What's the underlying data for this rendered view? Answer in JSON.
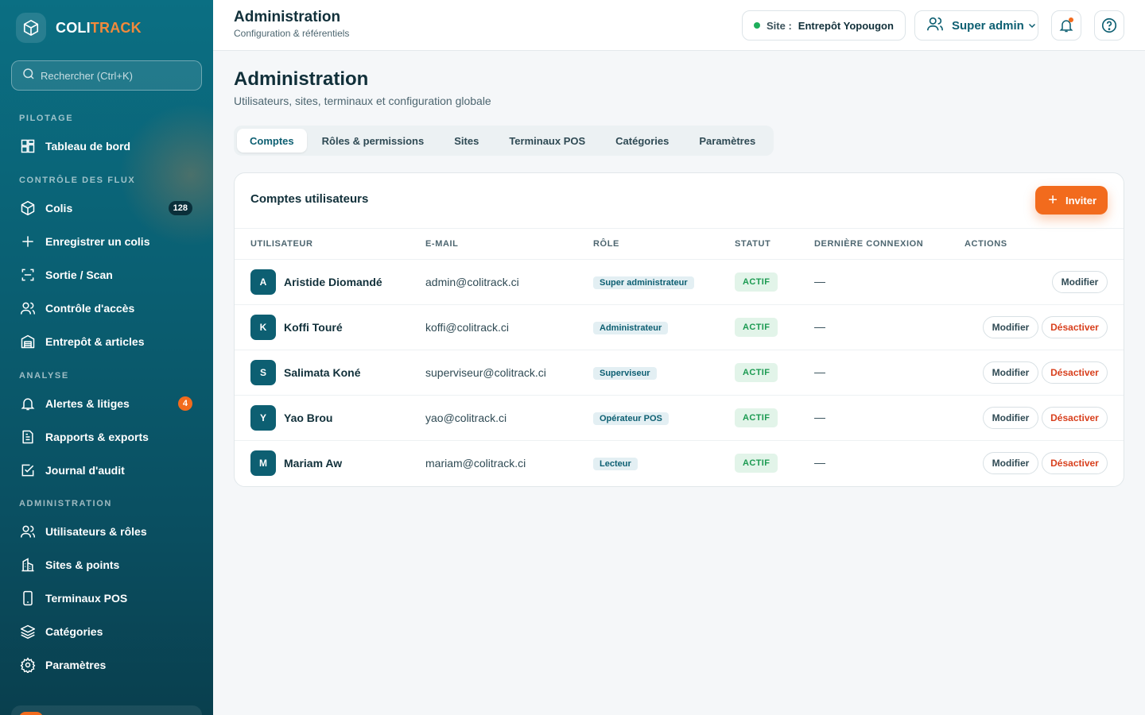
{
  "brand": {
    "name_part1": "COLI",
    "name_part2": "TRACK",
    "accent": "#f28a3c"
  },
  "sidebar": {
    "search_placeholder": "Rechercher (Ctrl+K)",
    "sections": {
      "pilotage": "PILOTAGE",
      "flux": "CONTRÔLE DES FLUX",
      "analyse": "ANALYSE",
      "admin": "ADMINISTRATION"
    },
    "items": {
      "dashboard": {
        "label": "Tableau de bord",
        "icon": "dashboard-icon"
      },
      "colis": {
        "label": "Colis",
        "icon": "package-icon",
        "badge": "128"
      },
      "register": {
        "label": "Enregistrer un colis",
        "icon": "plus-icon"
      },
      "scan": {
        "label": "Sortie / Scan",
        "icon": "scan-icon"
      },
      "access": {
        "label": "Contrôle d'accès",
        "icon": "users-icon"
      },
      "warehouse": {
        "label": "Entrepôt & articles",
        "icon": "warehouse-icon"
      },
      "alerts": {
        "label": "Alertes & litiges",
        "icon": "bell-icon",
        "badge": "4"
      },
      "reports": {
        "label": "Rapports & exports",
        "icon": "report-icon"
      },
      "audit": {
        "label": "Journal d'audit",
        "icon": "checklist-icon"
      },
      "users": {
        "label": "Utilisateurs & rôles",
        "icon": "users-icon"
      },
      "sites": {
        "label": "Sites & points",
        "icon": "building-icon"
      },
      "pos": {
        "label": "Terminaux POS",
        "icon": "device-icon"
      },
      "categories": {
        "label": "Catégories",
        "icon": "layers-icon"
      },
      "settings": {
        "label": "Paramètres",
        "icon": "gear-icon"
      }
    }
  },
  "topbar": {
    "title": "Administration",
    "subtitle": "Configuration & référentiels",
    "site_key": "Site :",
    "site_value": "Entrepôt Yopougon",
    "user_name": "Super admin",
    "status_color": "#1fae5b"
  },
  "main": {
    "title": "Administration",
    "subtitle": "Utilisateurs, sites, terminaux et configuration globale",
    "tabs": [
      "Comptes",
      "Rôles & permissions",
      "Sites",
      "Terminaux POS",
      "Catégories",
      "Paramètres"
    ],
    "active_tab": "Comptes"
  },
  "accounts": {
    "title": "Comptes utilisateurs",
    "invite_label": "Inviter",
    "columns": [
      "UTILISATEUR",
      "E-MAIL",
      "RÔLE",
      "STATUT",
      "DERNIÈRE CONNEXION",
      "ACTIONS"
    ],
    "rows": [
      {
        "initial": "A",
        "name": "Aristide Diomandé",
        "email": "admin@colitrack.ci",
        "role": "Super administrateur",
        "status": "ACTIF",
        "last_login": "—",
        "edit": "Modifier",
        "deactivate": ""
      },
      {
        "initial": "K",
        "name": "Koffi Touré",
        "email": "koffi@colitrack.ci",
        "role": "Administrateur",
        "status": "ACTIF",
        "last_login": "—",
        "edit": "Modifier",
        "deactivate": "Désactiver"
      },
      {
        "initial": "S",
        "name": "Salimata Koné",
        "email": "superviseur@colitrack.ci",
        "role": "Superviseur",
        "status": "ACTIF",
        "last_login": "—",
        "edit": "Modifier",
        "deactivate": "Désactiver"
      },
      {
        "initial": "Y",
        "name": "Yao Brou",
        "email": "yao@colitrack.ci",
        "role": "Opérateur POS",
        "status": "ACTIF",
        "last_login": "—",
        "edit": "Modifier",
        "deactivate": "Désactiver"
      },
      {
        "initial": "M",
        "name": "Mariam Aw",
        "email": "mariam@colitrack.ci",
        "role": "Lecteur",
        "status": "ACTIF",
        "last_login": "—",
        "edit": "Modifier",
        "deactivate": "Désactiver"
      }
    ]
  },
  "colors": {
    "primary": "#0d5f72",
    "accent": "#f26b1d",
    "danger": "#d8401e",
    "success": "#1b9a51"
  }
}
